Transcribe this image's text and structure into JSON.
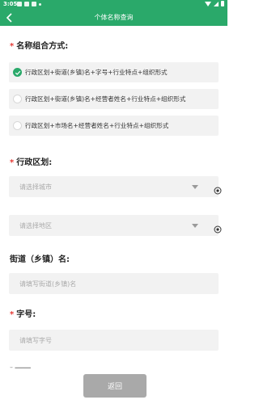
{
  "status_bar": {
    "time": "3:05"
  },
  "header": {
    "title": "个体名称查询",
    "back_icon": "chevron-left-icon"
  },
  "name_format": {
    "label": "名称组合方式:",
    "options": [
      {
        "text": "行政区划+街道(乡镇)名+字号+行业特点+组织形式",
        "checked": true
      },
      {
        "text": "行政区划+街道(乡镇)名+经营者姓名+行业特点+组织形式",
        "checked": false
      },
      {
        "text": "行政区划+市场名+经营者姓名+行业特点+组织形式",
        "checked": false
      }
    ]
  },
  "admin_division": {
    "label": "行政区划:",
    "city_placeholder": "请选择城市",
    "district_placeholder": "请选择地区"
  },
  "street": {
    "label": "街道（乡镇）名:",
    "placeholder": "请填写街道(乡镇)名"
  },
  "brand": {
    "label": "字号:",
    "placeholder": "请填写字号"
  },
  "bottom": {
    "return_label": "返回"
  },
  "colors": {
    "primary": "#2aa96a",
    "required": "#e53935",
    "button_gray": "#a9a9a9",
    "field_bg": "#f2f2f2"
  }
}
